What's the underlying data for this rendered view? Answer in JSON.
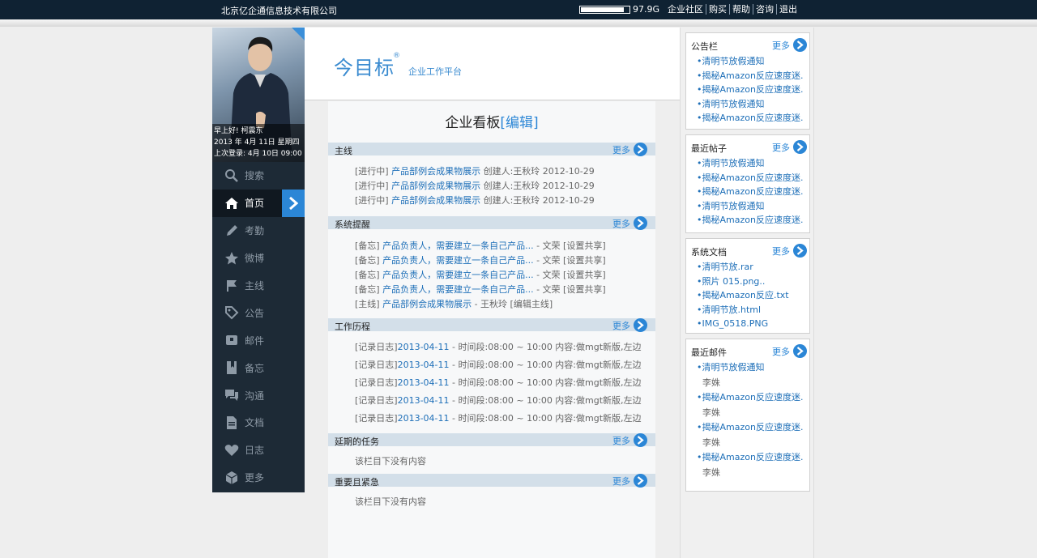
{
  "topbar": {
    "company": "北京亿企通信息技术有限公司",
    "storage_label": "97.9G",
    "storage_used": 0.9,
    "nav": [
      "企业社区",
      "购买",
      "帮助",
      "咨询",
      "退出"
    ]
  },
  "profile": {
    "greeting": "早上好! 柯震东",
    "date": "2013 年 4月 11日   星期四",
    "last_login": "上次登录:  4月 10日 09:00"
  },
  "sidebar": {
    "items": [
      {
        "label": "搜索",
        "icon": "search-icon"
      },
      {
        "label": "首页",
        "icon": "home-icon"
      },
      {
        "label": "考勤",
        "icon": "pencil-icon"
      },
      {
        "label": "微博",
        "icon": "star-icon"
      },
      {
        "label": "主线",
        "icon": "flag-icon"
      },
      {
        "label": "公告",
        "icon": "tag-icon"
      },
      {
        "label": "邮件",
        "icon": "inbox-icon"
      },
      {
        "label": "备忘",
        "icon": "bookmark-icon"
      },
      {
        "label": "沟通",
        "icon": "chat-icon"
      },
      {
        "label": "文档",
        "icon": "document-icon"
      },
      {
        "label": "日志",
        "icon": "heart-icon"
      },
      {
        "label": "更多",
        "icon": "cube-icon"
      }
    ]
  },
  "header": {
    "logo": "今目标",
    "reg": "®",
    "subtitle": "企业工作平台"
  },
  "board": {
    "title": "企业看板",
    "edit": "[编辑]",
    "more": "更多",
    "sections": {
      "mainline": {
        "title": "主线",
        "rows": [
          {
            "status": "[进行中]",
            "link": "产品部例会成果物展示",
            "tail": "创建人:王秋玲 2012-10-29"
          },
          {
            "status": "[进行中]",
            "link": "产品部例会成果物展示",
            "tail": "创建人:王秋玲 2012-10-29"
          },
          {
            "status": "[进行中]",
            "link": "产品部例会成果物展示",
            "tail": "创建人:王秋玲 2012-10-29"
          }
        ]
      },
      "reminders": {
        "title": "系统提醒",
        "rows": [
          {
            "status": "[备忘]",
            "link": "产品负责人，需要建立一条自己产品...",
            "tail": "- 文荣 [设置共享]"
          },
          {
            "status": "[备忘]",
            "link": "产品负责人，需要建立一条自己产品...",
            "tail": "- 文荣 [设置共享]"
          },
          {
            "status": "[备忘]",
            "link": "产品负责人，需要建立一条自己产品...",
            "tail": "- 文荣 [设置共享]"
          },
          {
            "status": "[备忘]",
            "link": "产品负责人，需要建立一条自己产品...",
            "tail": "- 文荣 [设置共享]"
          },
          {
            "status": "[主线]",
            "link": "产品部例会成果物展示",
            "tail": "- 王秋玲 [编辑主线]"
          }
        ]
      },
      "history": {
        "title": "工作历程",
        "rows": [
          {
            "status": "[记录日志]",
            "link": "2013-04-11",
            "tail": "- 时间段:08:00 ~ 10:00 内容:做mgt新版,左边"
          },
          {
            "status": "[记录日志]",
            "link": "2013-04-11",
            "tail": "- 时间段:08:00 ~ 10:00 内容:做mgt新版,左边"
          },
          {
            "status": "[记录日志]",
            "link": "2013-04-11",
            "tail": "- 时间段:08:00 ~ 10:00 内容:做mgt新版,左边"
          },
          {
            "status": "[记录日志]",
            "link": "2013-04-11",
            "tail": "- 时间段:08:00 ~ 10:00 内容:做mgt新版,左边"
          },
          {
            "status": "[记录日志]",
            "link": "2013-04-11",
            "tail": "- 时间段:08:00 ~ 10:00 内容:做mgt新版,左边"
          }
        ]
      },
      "delayed": {
        "title": "延期的任务",
        "empty": "该栏目下没有内容"
      },
      "urgent": {
        "title": "重要且紧急",
        "empty": "该栏目下没有内容"
      }
    }
  },
  "right": {
    "more": "更多",
    "notices": {
      "title": "公告栏",
      "items": [
        "•清明节放假通知",
        "•揭秘Amazon反应速度迷...",
        "•揭秘Amazon反应速度迷...",
        "•清明节放假通知",
        "•揭秘Amazon反应速度迷..."
      ]
    },
    "posts": {
      "title": "最近帖子",
      "items": [
        "•清明节放假通知",
        "•揭秘Amazon反应速度迷...",
        "•揭秘Amazon反应速度迷...",
        "•清明节放假通知",
        "•揭秘Amazon反应速度迷..."
      ]
    },
    "docs": {
      "title": "系统文档",
      "items": [
        "•清明节放.rar",
        "•照片 015.png..",
        "•揭秘Amazon反应.txt",
        "•清明节放.html",
        "•IMG_0518.PNG"
      ]
    },
    "mails": {
      "title": "最近邮件",
      "items": [
        {
          "subject": "•清明节放假通知",
          "author": "李姝"
        },
        {
          "subject": "•揭秘Amazon反应速度迷...",
          "author": "李姝"
        },
        {
          "subject": "•揭秘Amazon反应速度迷...",
          "author": "李姝"
        },
        {
          "subject": "•揭秘Amazon反应速度迷...",
          "author": "李姝"
        }
      ]
    }
  }
}
